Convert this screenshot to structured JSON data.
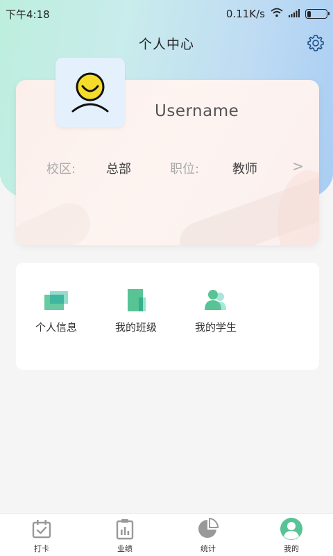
{
  "status_bar": {
    "time": "下午4:18",
    "network_speed": "0.11K/s",
    "battery_level": 0.2
  },
  "header": {
    "title": "个人中心",
    "settings_icon": "gear-icon"
  },
  "profile": {
    "avatar_icon": "smiley-avatar-icon",
    "username": "Username",
    "campus_label": "校区:",
    "campus_value": "总部",
    "position_label": "职位:",
    "position_value": "教师",
    "more_glyph": ">"
  },
  "menu": {
    "items": [
      {
        "label": "个人信息",
        "icon": "personal-info-icon"
      },
      {
        "label": "我的班级",
        "icon": "my-class-icon"
      },
      {
        "label": "我的学生",
        "icon": "my-students-icon"
      }
    ]
  },
  "tab_bar": {
    "items": [
      {
        "label": "打卡",
        "icon": "check-in-icon",
        "active": false
      },
      {
        "label": "业绩",
        "icon": "performance-icon",
        "active": false
      },
      {
        "label": "统计",
        "icon": "statistics-icon",
        "active": false
      },
      {
        "label": "我的",
        "icon": "profile-icon",
        "active": true
      }
    ]
  },
  "colors": {
    "accent_green": "#58c496",
    "icon_gray": "#999999",
    "header_gradient_start": "#bdeedd",
    "header_gradient_end": "#a9cdf3"
  }
}
